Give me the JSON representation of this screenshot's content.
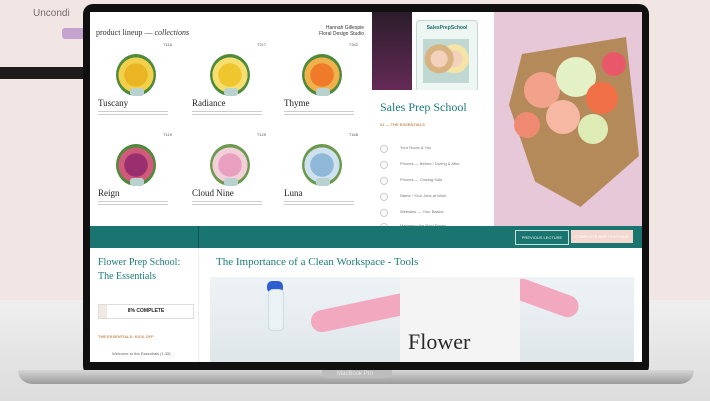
{
  "background": {
    "partial_text": "Uncondi"
  },
  "laptop": {
    "brand": "MacBook Pro"
  },
  "lineup": {
    "title": "product lineup",
    "title_italic": "collections",
    "name_line1": "Hannah Gillespie",
    "name_line2": "Floral Design Studio",
    "products": [
      {
        "name": "Tuscany",
        "code": "T116",
        "color": "#e9b524"
      },
      {
        "name": "Radiance",
        "code": "T217",
        "color": "#f0c62e"
      },
      {
        "name": "Thyme",
        "code": "T342",
        "color": "#ee7a2a"
      },
      {
        "name": "Reign",
        "code": "T119",
        "color": "#9a2f6f"
      },
      {
        "name": "Cloud Nine",
        "code": "T125",
        "color": "#e9a0c0"
      },
      {
        "name": "Luna",
        "code": "T168",
        "color": "#8fb7d8"
      }
    ]
  },
  "phone": {
    "title": "SalesPrepSchool"
  },
  "sales": {
    "title": "Sales Prep School",
    "subtitle": "01 — THE ESSENTIALS",
    "lessons": [
      "Your Roots & You",
      "Phones — Before / During & After",
      "Phones — Closing Sale",
      "Name / Your Jobs at Work",
      "Websites — Your Basics",
      "Managing the Real Florist"
    ]
  },
  "nav": {
    "prev": "PREVIOUS LECTURE",
    "next": "COMPLETE AND CONTINUE"
  },
  "course": {
    "title": "Flower Prep School: The Essentials",
    "progress_text": "8% COMPLETE",
    "progress_value": 0.08,
    "section": "THE ESSENTIALS: KICK OFF",
    "first_lesson": "Welcome to the Essentials (1:35)"
  },
  "lesson": {
    "title": "The Importance of a Clean Workspace - Tools",
    "apron_text": "Flower"
  }
}
